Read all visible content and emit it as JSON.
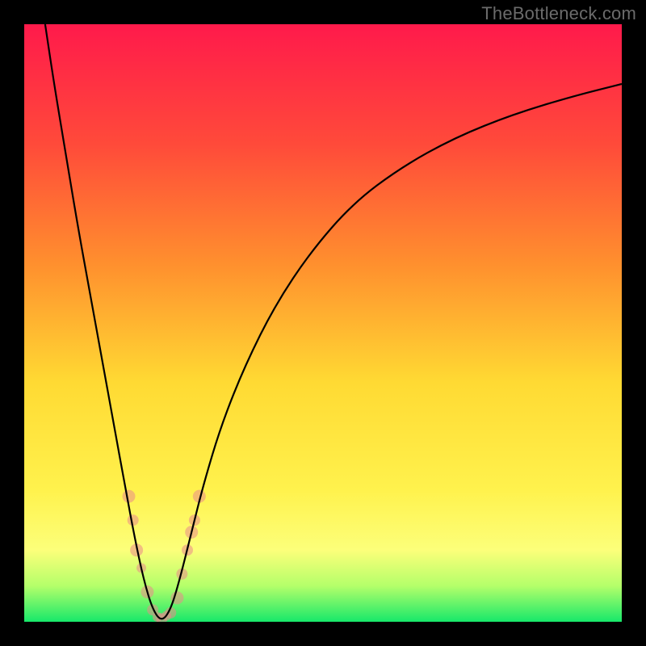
{
  "attribution": "TheBottleneck.com",
  "chart_data": {
    "type": "line",
    "title": "",
    "xlabel": "",
    "ylabel": "",
    "xlim": [
      0,
      100
    ],
    "ylim": [
      0,
      100
    ],
    "gradient_stops": [
      {
        "offset": 0,
        "color": "#ff1a4b"
      },
      {
        "offset": 0.2,
        "color": "#ff4a3a"
      },
      {
        "offset": 0.4,
        "color": "#ff8f2e"
      },
      {
        "offset": 0.6,
        "color": "#ffda33"
      },
      {
        "offset": 0.78,
        "color": "#fff24d"
      },
      {
        "offset": 0.88,
        "color": "#fcff7a"
      },
      {
        "offset": 0.94,
        "color": "#b4ff6a"
      },
      {
        "offset": 1.0,
        "color": "#17e86a"
      }
    ],
    "series": [
      {
        "name": "curve",
        "type": "line",
        "stroke": "#000000",
        "points": [
          {
            "x": 3.5,
            "y": 100
          },
          {
            "x": 5,
            "y": 90
          },
          {
            "x": 7,
            "y": 78
          },
          {
            "x": 9,
            "y": 66
          },
          {
            "x": 11,
            "y": 55
          },
          {
            "x": 13,
            "y": 44
          },
          {
            "x": 15,
            "y": 33
          },
          {
            "x": 17,
            "y": 22
          },
          {
            "x": 18.5,
            "y": 14
          },
          {
            "x": 20,
            "y": 7
          },
          {
            "x": 21.5,
            "y": 2
          },
          {
            "x": 23,
            "y": 0
          },
          {
            "x": 24.5,
            "y": 2
          },
          {
            "x": 26,
            "y": 7
          },
          {
            "x": 28,
            "y": 15
          },
          {
            "x": 30,
            "y": 23
          },
          {
            "x": 33,
            "y": 33
          },
          {
            "x": 37,
            "y": 43
          },
          {
            "x": 42,
            "y": 53
          },
          {
            "x": 48,
            "y": 62
          },
          {
            "x": 55,
            "y": 70
          },
          {
            "x": 63,
            "y": 76
          },
          {
            "x": 72,
            "y": 81
          },
          {
            "x": 82,
            "y": 85
          },
          {
            "x": 92,
            "y": 88
          },
          {
            "x": 100,
            "y": 90
          }
        ]
      },
      {
        "name": "left-cluster",
        "type": "scatter",
        "opacity": 0.55,
        "fill": "#e98a8a",
        "points": [
          {
            "x": 17.5,
            "y": 21,
            "r": 8
          },
          {
            "x": 18.2,
            "y": 17,
            "r": 7
          },
          {
            "x": 18.8,
            "y": 12,
            "r": 8
          },
          {
            "x": 19.6,
            "y": 9,
            "r": 6
          },
          {
            "x": 20.6,
            "y": 5,
            "r": 8
          },
          {
            "x": 21.5,
            "y": 2,
            "r": 7
          },
          {
            "x": 22.3,
            "y": 0.8,
            "r": 6
          },
          {
            "x": 23.0,
            "y": 0.5,
            "r": 7
          },
          {
            "x": 23.8,
            "y": 1,
            "r": 6
          },
          {
            "x": 24.5,
            "y": 1.5,
            "r": 7
          },
          {
            "x": 25.6,
            "y": 4,
            "r": 8
          },
          {
            "x": 26.4,
            "y": 8,
            "r": 7
          },
          {
            "x": 27.3,
            "y": 12,
            "r": 7
          },
          {
            "x": 28.0,
            "y": 15,
            "r": 8
          },
          {
            "x": 28.5,
            "y": 17,
            "r": 7
          },
          {
            "x": 29.3,
            "y": 21,
            "r": 8
          }
        ]
      }
    ]
  }
}
